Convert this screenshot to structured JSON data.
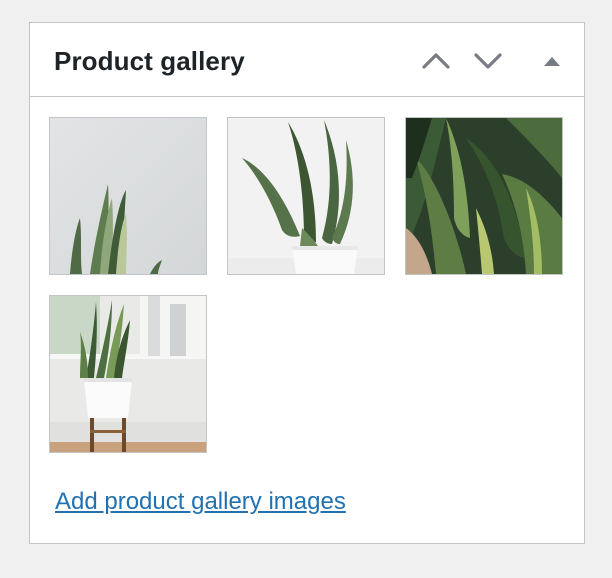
{
  "panel": {
    "title": "Product gallery",
    "move_up_icon": "chevron-up-icon",
    "move_down_icon": "chevron-down-icon",
    "toggle_icon": "triangle-up-icon"
  },
  "gallery": {
    "images": [
      {
        "name": "snake-plant-grey-background"
      },
      {
        "name": "snake-plant-white-pot"
      },
      {
        "name": "snake-plant-leaves-closeup"
      },
      {
        "name": "snake-plant-wooden-stand"
      }
    ]
  },
  "add_link": {
    "label": "Add product gallery images",
    "color": "#2271b1"
  },
  "colors": {
    "background": "#f0f0f1",
    "panel_border": "#c3c4c7",
    "title": "#1d2327",
    "icon": "#787c82"
  }
}
